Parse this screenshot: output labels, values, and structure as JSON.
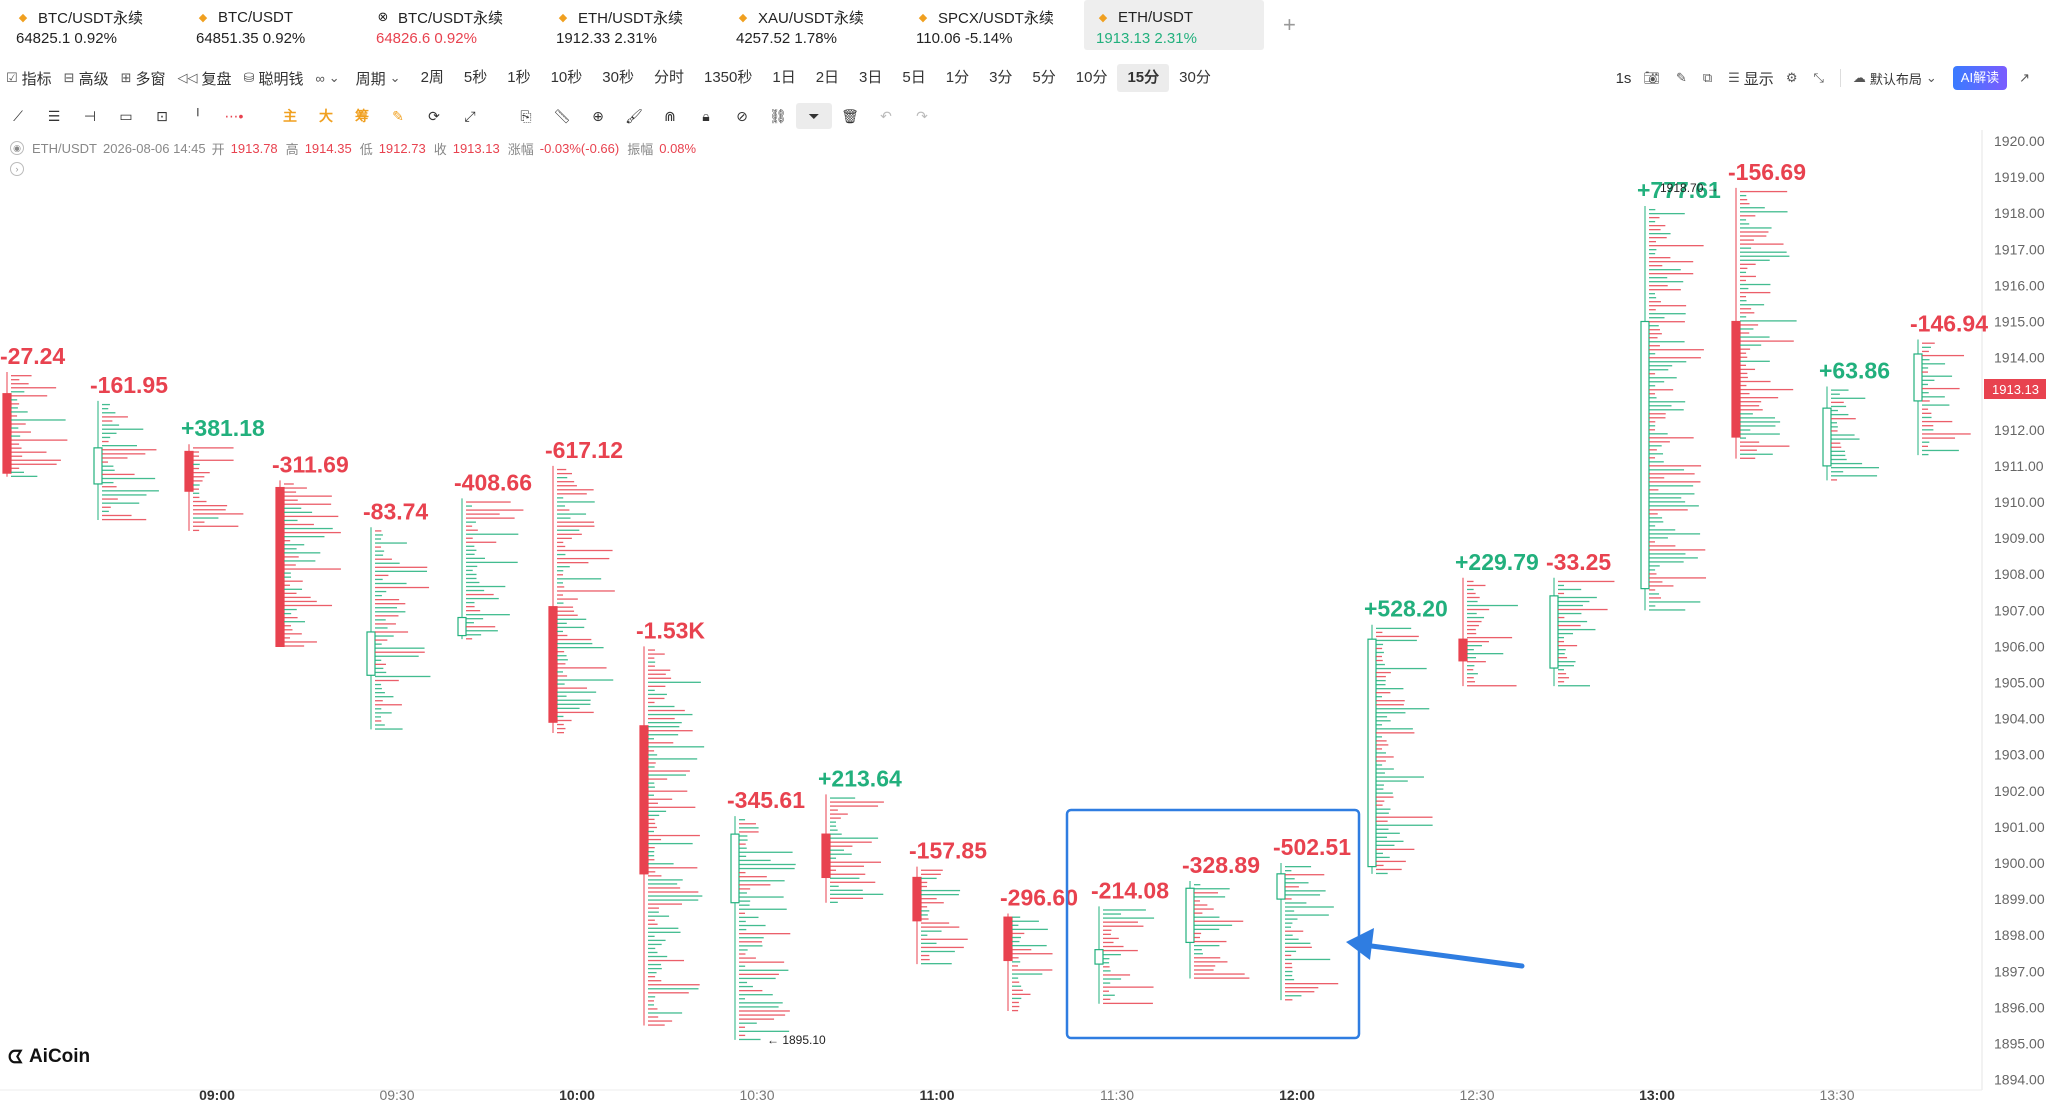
{
  "tickers": [
    {
      "name": "BTC/USDT永续",
      "value": "64825.1 0.92%",
      "icon": "diamond-icon",
      "color": "dark"
    },
    {
      "name": "BTC/USDT",
      "value": "64851.35 0.92%",
      "icon": "diamond-icon",
      "color": "dark"
    },
    {
      "name": "BTC/USDT永续",
      "value": "64826.6 0.92%",
      "icon": "exchange-x-icon",
      "color": "red"
    },
    {
      "name": "ETH/USDT永续",
      "value": "1912.33 2.31%",
      "icon": "diamond-icon",
      "color": "dark"
    },
    {
      "name": "XAU/USDT永续",
      "value": "4257.52 1.78%",
      "icon": "diamond-icon",
      "color": "dark"
    },
    {
      "name": "SPCX/USDT永续",
      "value": "110.06 -5.14%",
      "icon": "diamond-icon",
      "color": "dark"
    },
    {
      "name": "ETH/USDT",
      "value": "1913.13 2.31%",
      "icon": "diamond-icon",
      "color": "green",
      "active": true
    }
  ],
  "toolbar": {
    "indicators": "指标",
    "advanced": "高级",
    "multi": "多窗",
    "replay": "复盘",
    "smart": "聪明钱",
    "cycle": "周期",
    "periods": [
      "2周",
      "5秒",
      "1秒",
      "10秒",
      "30秒",
      "分时",
      "1350秒",
      "1日",
      "2日",
      "3日",
      "5日",
      "1分",
      "3分",
      "5分",
      "10分",
      "15分",
      "30分"
    ],
    "selected_period": "15分",
    "interval": "1s",
    "display": "显示",
    "layout": "默认布局",
    "ai": "AI解读"
  },
  "tools": {
    "main": "主",
    "big": "大",
    "chip": "筹"
  },
  "info": {
    "symbol": "ETH/USDT",
    "datetime": "2026-08-06 14:45",
    "open_label": "开",
    "open": "1913.78",
    "high_label": "高",
    "high": "1914.35",
    "low_label": "低",
    "low": "1912.73",
    "close_label": "收",
    "close": "1913.13",
    "change_label": "涨幅",
    "change": "-0.03%(-0.66)",
    "amp_label": "振幅",
    "amp": "0.08%"
  },
  "logo": "AiCoin",
  "colors": {
    "up": "#22b07d",
    "down": "#e8424f",
    "highlight": "#2f7de1"
  },
  "chart_data": {
    "type": "candlestick-footprint",
    "y_ticks": [
      "1920.00",
      "1919.00",
      "1918.00",
      "1917.00",
      "1916.00",
      "1915.00",
      "1914.00",
      "1913.00",
      "1912.00",
      "1911.00",
      "1910.00",
      "1909.00",
      "1908.00",
      "1907.00",
      "1906.00",
      "1905.00",
      "1904.00",
      "1903.00",
      "1902.00",
      "1901.00",
      "1900.00",
      "1899.00",
      "1898.00",
      "1897.00",
      "1896.00",
      "1895.00",
      "1894.00"
    ],
    "ylim": [
      1893.6,
      1920.4
    ],
    "x_ticks": [
      "09:00",
      "09:30",
      "10:00",
      "10:30",
      "11:00",
      "11:30",
      "12:00",
      "12:30",
      "13:00",
      "13:30"
    ],
    "bold_x_ticks": [
      "09:00",
      "10:00",
      "11:00",
      "12:00",
      "13:00"
    ],
    "current_price": "1913.13",
    "high_marker": "1918.70",
    "low_marker": "1895.10",
    "candles": [
      {
        "open": 1913.0,
        "close": 1910.8,
        "high": 1913.6,
        "low": 1910.7,
        "delta": "-27.24",
        "up": false
      },
      {
        "open": 1910.5,
        "close": 1911.5,
        "high": 1912.8,
        "low": 1909.5,
        "delta": "-161.95",
        "up": true
      },
      {
        "open": 1911.4,
        "close": 1910.3,
        "high": 1911.6,
        "low": 1909.2,
        "delta": "+381.18",
        "up": false
      },
      {
        "open": 1910.4,
        "close": 1906.0,
        "high": 1910.6,
        "low": 1906.0,
        "delta": "-311.69",
        "up": false
      },
      {
        "open": 1905.2,
        "close": 1906.4,
        "high": 1909.3,
        "low": 1903.7,
        "delta": "-83.74",
        "up": true
      },
      {
        "open": 1906.3,
        "close": 1906.8,
        "high": 1910.1,
        "low": 1906.2,
        "delta": "-408.66",
        "up": true
      },
      {
        "open": 1907.1,
        "close": 1903.9,
        "high": 1911.0,
        "low": 1903.6,
        "delta": "-617.12",
        "up": false
      },
      {
        "open": 1903.8,
        "close": 1899.7,
        "high": 1906.0,
        "low": 1895.5,
        "delta": "-1.53K",
        "up": false
      },
      {
        "open": 1898.9,
        "close": 1900.8,
        "high": 1901.3,
        "low": 1895.1,
        "delta": "-345.61",
        "up": true
      },
      {
        "open": 1900.8,
        "close": 1899.6,
        "high": 1901.9,
        "low": 1898.9,
        "delta": "+213.64",
        "up": false
      },
      {
        "open": 1899.6,
        "close": 1898.4,
        "high": 1899.9,
        "low": 1897.2,
        "delta": "-157.85",
        "up": false
      },
      {
        "open": 1898.5,
        "close": 1897.3,
        "high": 1898.6,
        "low": 1895.9,
        "delta": "-296.60",
        "up": false
      },
      {
        "open": 1897.2,
        "close": 1897.6,
        "high": 1898.8,
        "low": 1896.1,
        "delta": "-214.08",
        "up": true
      },
      {
        "open": 1897.8,
        "close": 1899.3,
        "high": 1899.5,
        "low": 1896.8,
        "delta": "-328.89",
        "up": true
      },
      {
        "open": 1899.0,
        "close": 1899.7,
        "high": 1900.0,
        "low": 1896.2,
        "delta": "-502.51",
        "up": true
      },
      {
        "open": 1899.9,
        "close": 1906.2,
        "high": 1906.6,
        "low": 1899.7,
        "delta": "+528.20",
        "up": true
      },
      {
        "open": 1906.2,
        "close": 1905.6,
        "high": 1907.9,
        "low": 1904.9,
        "delta": "+229.79",
        "up": false
      },
      {
        "open": 1905.4,
        "close": 1907.4,
        "high": 1907.9,
        "low": 1904.9,
        "delta": "-33.25",
        "up": true
      },
      {
        "open": 1907.6,
        "close": 1915.0,
        "high": 1918.2,
        "low": 1907.0,
        "delta": "+777.61",
        "up": true
      },
      {
        "open": 1915.0,
        "close": 1911.8,
        "high": 1918.7,
        "low": 1911.2,
        "delta": "-156.69",
        "up": false
      },
      {
        "open": 1911.0,
        "close": 1912.6,
        "high": 1913.2,
        "low": 1910.6,
        "delta": "+63.86",
        "up": true
      },
      {
        "open": 1912.8,
        "close": 1914.1,
        "high": 1914.5,
        "low": 1911.3,
        "delta": "-146.94",
        "up": true
      }
    ],
    "highlight_range": [
      12,
      14
    ]
  }
}
